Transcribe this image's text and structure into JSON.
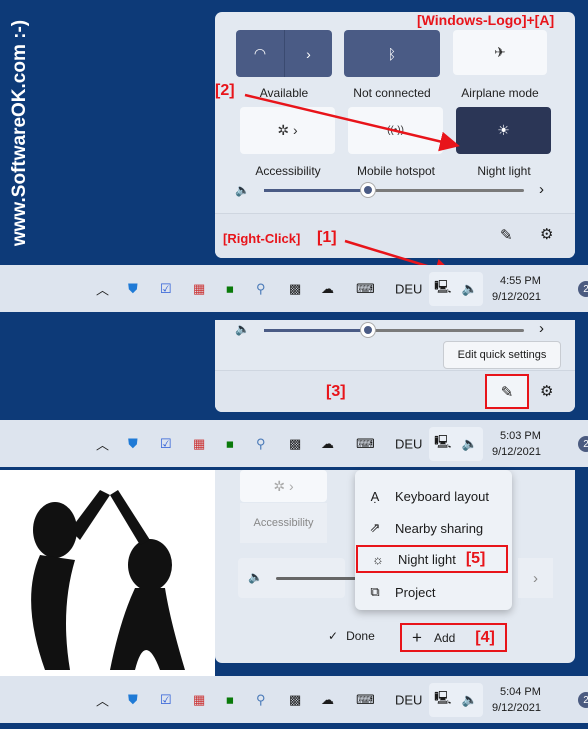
{
  "watermark": "www.SoftwareOK.com :-)",
  "annotations": {
    "shortcut": "[Windows-Logo]+[A]",
    "step1": "[1]",
    "right_click": "[Right-Click]",
    "step2": "[2]",
    "step3": "[3]",
    "step4": "[4]",
    "step5": "[5]"
  },
  "quick_settings": {
    "tiles": [
      {
        "label": "Available",
        "icon": "wifi-icon",
        "state": "on"
      },
      {
        "label": "Not connected",
        "icon": "bluetooth-icon",
        "state": "on"
      },
      {
        "label": "Airplane mode",
        "icon": "airplane-icon",
        "state": "off"
      },
      {
        "label": "Accessibility",
        "icon": "accessibility-icon",
        "state": "off"
      },
      {
        "label": "Mobile hotspot",
        "icon": "hotspot-icon",
        "state": "off"
      },
      {
        "label": "Night light",
        "icon": "night-light-icon",
        "state": "on"
      }
    ],
    "volume_percent": 40
  },
  "tooltip": "Edit quick settings",
  "add_menu": {
    "items": [
      {
        "label": "Keyboard layout",
        "icon": "keyboard-layout-icon"
      },
      {
        "label": "Nearby sharing",
        "icon": "nearby-sharing-icon"
      },
      {
        "label": "Night light",
        "icon": "night-light-icon"
      },
      {
        "label": "Project",
        "icon": "project-icon"
      }
    ],
    "done": "Done",
    "add": "Add",
    "accessibility": "Accessibility"
  },
  "taskbars": [
    {
      "lang": "DEU",
      "time": "4:55 PM",
      "date": "9/12/2021",
      "badge": "2"
    },
    {
      "lang": "DEU",
      "time": "5:03 PM",
      "date": "9/12/2021",
      "badge": "2"
    },
    {
      "lang": "DEU",
      "time": "5:04 PM",
      "date": "9/12/2021",
      "badge": "2"
    }
  ],
  "colors": {
    "accent": "#4a5b85",
    "annotation": "#e8141a",
    "background": "#0d3a78"
  }
}
